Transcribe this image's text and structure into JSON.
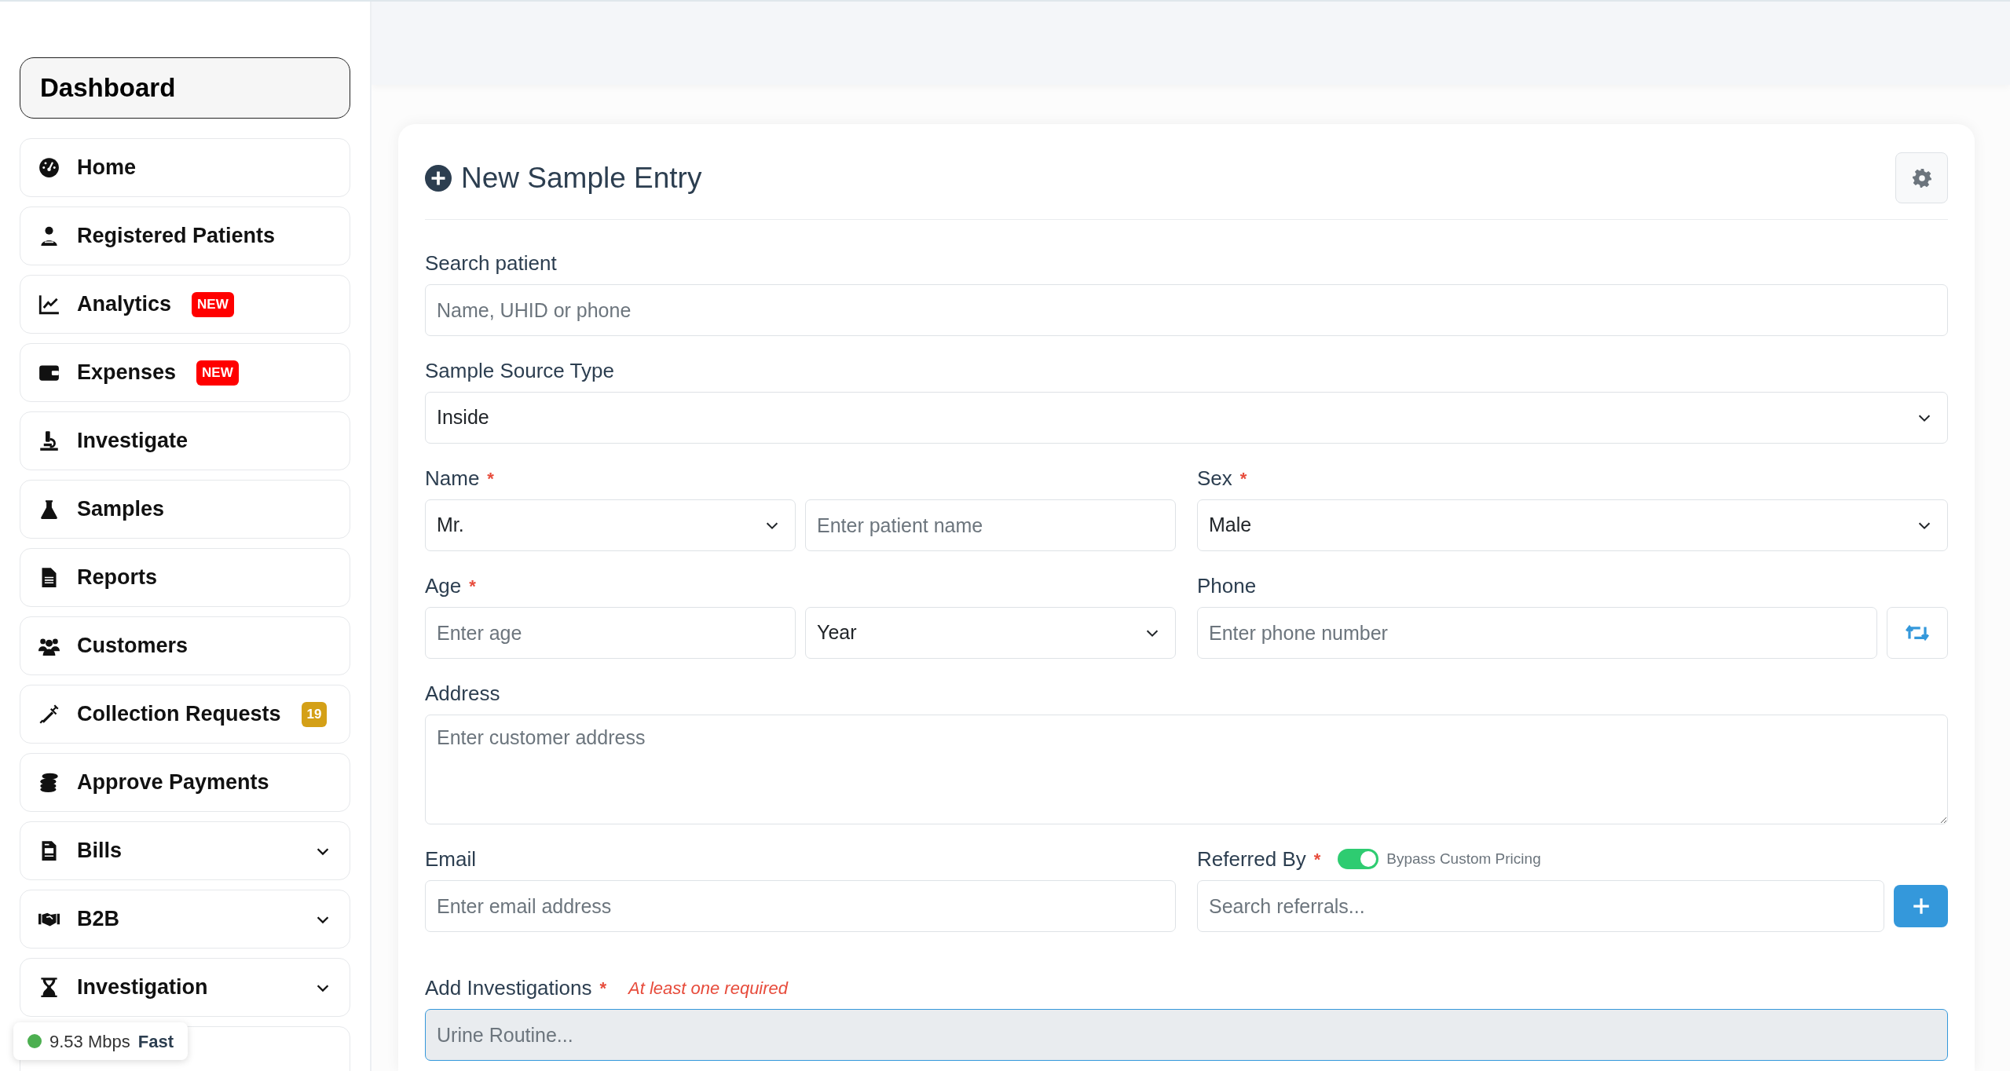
{
  "sidebar": {
    "header": "Dashboard",
    "items": [
      {
        "label": "Home",
        "kind": "link"
      },
      {
        "label": "Registered Patients",
        "kind": "link"
      },
      {
        "label": "Analytics",
        "kind": "link",
        "badge": {
          "text": "NEW",
          "color": "#ff0000"
        }
      },
      {
        "label": "Expenses",
        "kind": "link",
        "badge": {
          "text": "NEW",
          "color": "#ff0000"
        }
      },
      {
        "label": "Investigate",
        "kind": "link"
      },
      {
        "label": "Samples",
        "kind": "link"
      },
      {
        "label": "Reports",
        "kind": "link"
      },
      {
        "label": "Customers",
        "kind": "link"
      },
      {
        "label": "Collection Requests",
        "kind": "link",
        "badge": {
          "text": "19",
          "color": "#d4a017"
        }
      },
      {
        "label": "Approve Payments",
        "kind": "link"
      },
      {
        "label": "Bills",
        "kind": "group"
      },
      {
        "label": "B2B",
        "kind": "group"
      },
      {
        "label": "Investigation",
        "kind": "group"
      },
      {
        "kind": "link"
      }
    ],
    "network_status": {
      "speed": "9.53 Mbps",
      "quality": "Fast"
    }
  },
  "form": {
    "title": "New Sample Entry",
    "search_patient": {
      "label": "Search patient",
      "placeholder": "Name, UHID or phone"
    },
    "sample_source_type": {
      "label": "Sample Source Type",
      "value": "Inside"
    },
    "name": {
      "label": "Name",
      "required_mark": "*",
      "title_value": "Mr.",
      "placeholder": "Enter patient name"
    },
    "sex": {
      "label": "Sex",
      "required_mark": "*",
      "value": "Male"
    },
    "age": {
      "label": "Age",
      "required_mark": "*",
      "placeholder": "Enter age",
      "unit_value": "Year"
    },
    "phone": {
      "label": "Phone",
      "placeholder": "Enter phone number"
    },
    "address": {
      "label": "Address",
      "placeholder": "Enter customer address"
    },
    "email": {
      "label": "Email",
      "placeholder": "Enter email address"
    },
    "referred_by": {
      "label": "Referred By",
      "required_mark": "*",
      "toggle": {
        "label": "Bypass Custom Pricing",
        "on": true
      },
      "placeholder": "Search referrals..."
    },
    "investigations": {
      "label": "Add Investigations",
      "required_mark": "*",
      "hint": "At least one required",
      "placeholder": "Urine Routine..."
    }
  }
}
